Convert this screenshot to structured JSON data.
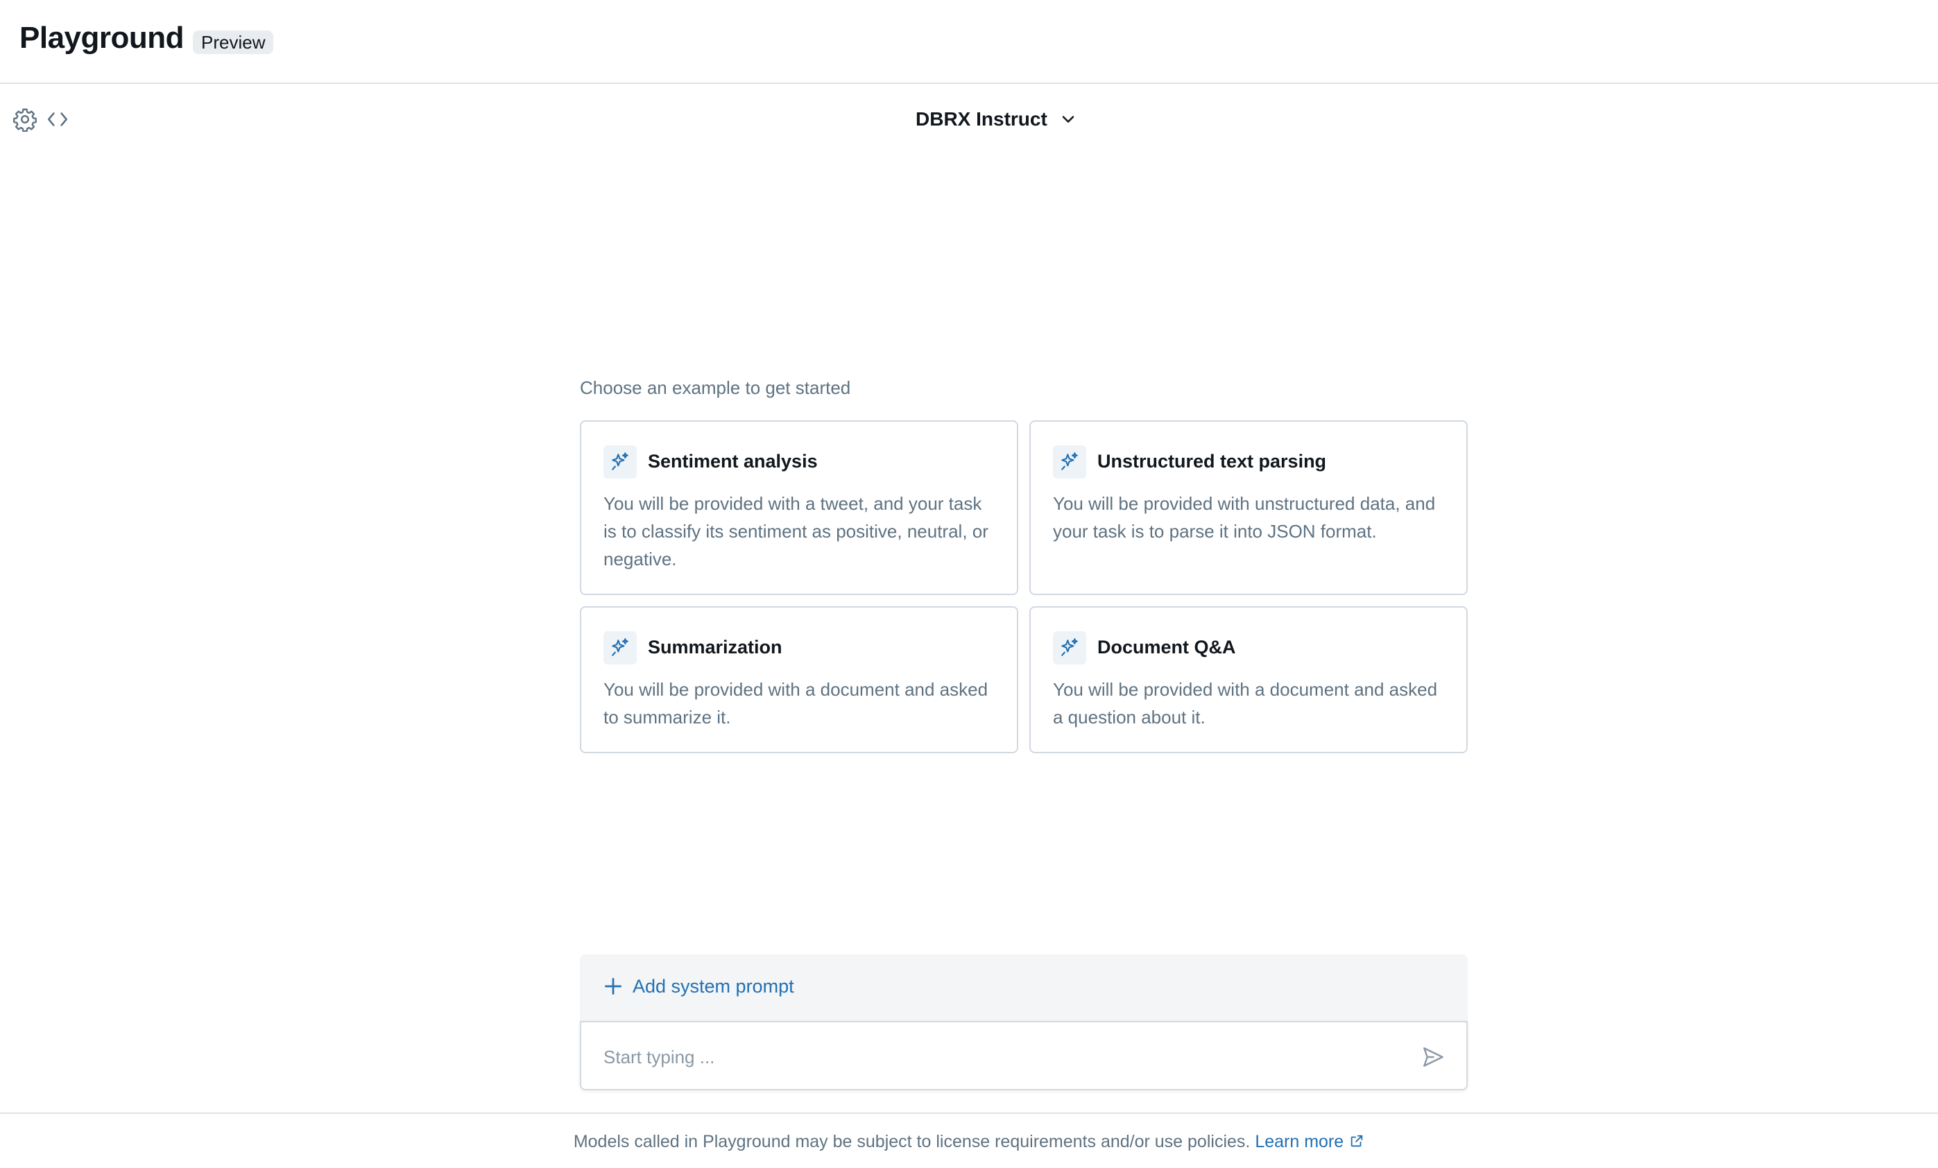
{
  "header": {
    "title": "Playground",
    "badge": "Preview"
  },
  "toolbar": {
    "icons": [
      "gear-icon",
      "code-icon"
    ],
    "model_select": {
      "selected": "DBRX Instruct",
      "icon": "chevron-down-icon"
    }
  },
  "examples": {
    "heading": "Choose an example to get started",
    "icon": "sparkle-icon",
    "cards": [
      {
        "title": "Sentiment analysis",
        "description": "You will be provided with a tweet, and your task is to classify its sentiment as positive, neutral, or negative."
      },
      {
        "title": "Unstructured text parsing",
        "description": "You will be provided with unstructured data, and your task is to parse it into JSON format."
      },
      {
        "title": "Summarization",
        "description": "You will be provided with a document and asked to summarize it."
      },
      {
        "title": "Document Q&A",
        "description": "You will be provided with a document and asked a question about it."
      }
    ]
  },
  "prompt": {
    "add_system_prompt_label": "Add system prompt",
    "input_placeholder": "Start typing ...",
    "input_value": "",
    "send_icon": "send-icon"
  },
  "footer": {
    "text": "Models called in Playground may be subject to license requirements and/or use policies.",
    "link_label": "Learn more",
    "link_icon": "external-link-icon"
  },
  "colors": {
    "accent": "#2270b2",
    "text_primary": "#11171c",
    "text_secondary": "#5f7281",
    "border": "#d1d9e1"
  }
}
